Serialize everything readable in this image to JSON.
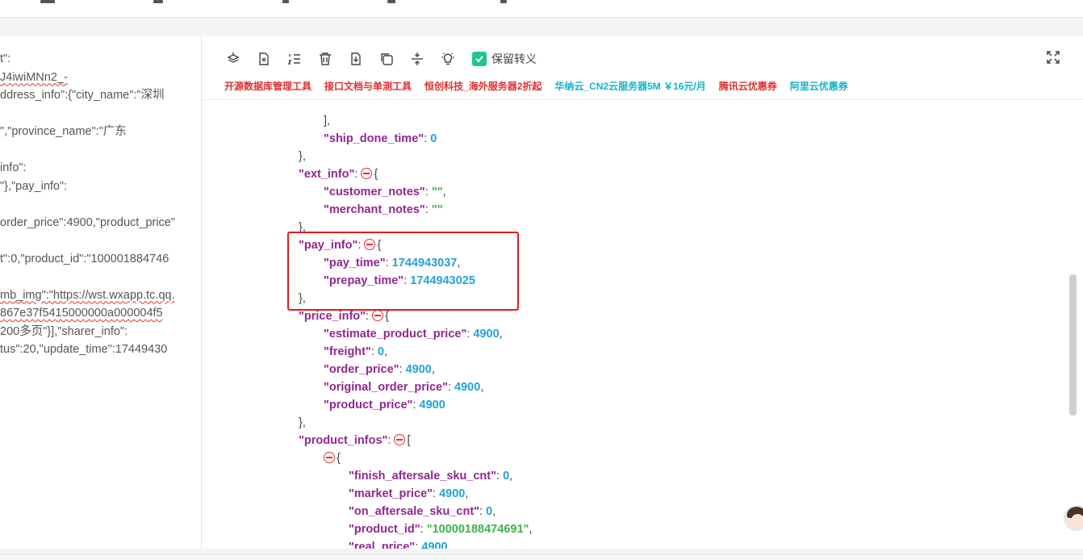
{
  "raw_lines": [
    "t\":",
    "J4iwiMNn2_-",
    "ddress_info\":{\"city_name\":\"深圳",
    "",
    "\",\"province_name\":\"广东",
    "",
    "info\":",
    "\"},\"pay_info\":",
    "",
    "order_price\":4900,\"product_price\"",
    "",
    "t\":0,\"product_id\":\"100001884746",
    "",
    "mb_img\":\"https://wst.wxapp.tc.qq.",
    "867e37f5415000000a000004f5",
    "200多页\"}],\"sharer_info\":",
    "tus\":20,\"update_time\":17449430"
  ],
  "toolbar": {
    "keep_escape_label": "保留转义",
    "links": [
      {
        "label": "开源数据库管理工具",
        "color": "#e03030"
      },
      {
        "label": "接口文档与单测工具",
        "color": "#e03030"
      },
      {
        "label": "恒创科技_海外服务器2折起",
        "color": "#e03030"
      },
      {
        "label": "华纳云_CN2云服务器5M ￥16元/月",
        "color": "#17b3c8"
      },
      {
        "label": "腾讯云优惠券",
        "color": "#e03030"
      },
      {
        "label": "阿里云优惠券",
        "color": "#17b3c8"
      }
    ]
  },
  "json_view": {
    "lines": [
      {
        "indent": 2,
        "parts": [
          {
            "t": "punct",
            "v": "],"
          }
        ]
      },
      {
        "indent": 2,
        "parts": [
          {
            "t": "key",
            "v": "\"ship_done_time\""
          },
          {
            "t": "punct",
            "v": ": "
          },
          {
            "t": "num",
            "v": "0"
          }
        ]
      },
      {
        "indent": 1,
        "parts": [
          {
            "t": "punct",
            "v": "},"
          }
        ]
      },
      {
        "indent": 1,
        "parts": [
          {
            "t": "key",
            "v": "\"ext_info\""
          },
          {
            "t": "punct",
            "v": ": "
          },
          {
            "t": "fold"
          },
          {
            "t": "punct",
            "v": "{"
          }
        ]
      },
      {
        "indent": 2,
        "parts": [
          {
            "t": "key",
            "v": "\"customer_notes\""
          },
          {
            "t": "punct",
            "v": ": "
          },
          {
            "t": "str",
            "v": "\"\""
          },
          {
            "t": "punct",
            "v": ","
          }
        ]
      },
      {
        "indent": 2,
        "parts": [
          {
            "t": "key",
            "v": "\"merchant_notes\""
          },
          {
            "t": "punct",
            "v": ": "
          },
          {
            "t": "str",
            "v": "\"\""
          }
        ]
      },
      {
        "indent": 1,
        "parts": [
          {
            "t": "punct",
            "v": "},"
          }
        ]
      },
      {
        "indent": 1,
        "parts": [
          {
            "t": "key",
            "v": "\"pay_info\""
          },
          {
            "t": "punct",
            "v": ": "
          },
          {
            "t": "fold"
          },
          {
            "t": "punct",
            "v": "{"
          }
        ]
      },
      {
        "indent": 2,
        "parts": [
          {
            "t": "key",
            "v": "\"pay_time\""
          },
          {
            "t": "punct",
            "v": ": "
          },
          {
            "t": "num",
            "v": "1744943037"
          },
          {
            "t": "punct",
            "v": ","
          }
        ]
      },
      {
        "indent": 2,
        "parts": [
          {
            "t": "key",
            "v": "\"prepay_time\""
          },
          {
            "t": "punct",
            "v": ": "
          },
          {
            "t": "num",
            "v": "1744943025"
          }
        ]
      },
      {
        "indent": 1,
        "parts": [
          {
            "t": "punct",
            "v": "},"
          }
        ]
      },
      {
        "indent": 1,
        "parts": [
          {
            "t": "key",
            "v": "\"price_info\""
          },
          {
            "t": "punct",
            "v": ": "
          },
          {
            "t": "fold"
          },
          {
            "t": "punct",
            "v": "{"
          }
        ]
      },
      {
        "indent": 2,
        "parts": [
          {
            "t": "key",
            "v": "\"estimate_product_price\""
          },
          {
            "t": "punct",
            "v": ": "
          },
          {
            "t": "num",
            "v": "4900"
          },
          {
            "t": "punct",
            "v": ","
          }
        ]
      },
      {
        "indent": 2,
        "parts": [
          {
            "t": "key",
            "v": "\"freight\""
          },
          {
            "t": "punct",
            "v": ": "
          },
          {
            "t": "num",
            "v": "0"
          },
          {
            "t": "punct",
            "v": ","
          }
        ]
      },
      {
        "indent": 2,
        "parts": [
          {
            "t": "key",
            "v": "\"order_price\""
          },
          {
            "t": "punct",
            "v": ": "
          },
          {
            "t": "num",
            "v": "4900"
          },
          {
            "t": "punct",
            "v": ","
          }
        ]
      },
      {
        "indent": 2,
        "parts": [
          {
            "t": "key",
            "v": "\"original_order_price\""
          },
          {
            "t": "punct",
            "v": ": "
          },
          {
            "t": "num",
            "v": "4900"
          },
          {
            "t": "punct",
            "v": ","
          }
        ]
      },
      {
        "indent": 2,
        "parts": [
          {
            "t": "key",
            "v": "\"product_price\""
          },
          {
            "t": "punct",
            "v": ": "
          },
          {
            "t": "num",
            "v": "4900"
          }
        ]
      },
      {
        "indent": 1,
        "parts": [
          {
            "t": "punct",
            "v": "},"
          }
        ]
      },
      {
        "indent": 1,
        "parts": [
          {
            "t": "key",
            "v": "\"product_infos\""
          },
          {
            "t": "punct",
            "v": ": "
          },
          {
            "t": "fold"
          },
          {
            "t": "punct",
            "v": "["
          }
        ]
      },
      {
        "indent": 2,
        "parts": [
          {
            "t": "fold"
          },
          {
            "t": "punct",
            "v": "{"
          }
        ]
      },
      {
        "indent": 3,
        "parts": [
          {
            "t": "key",
            "v": "\"finish_aftersale_sku_cnt\""
          },
          {
            "t": "punct",
            "v": ": "
          },
          {
            "t": "num",
            "v": "0"
          },
          {
            "t": "punct",
            "v": ","
          }
        ]
      },
      {
        "indent": 3,
        "parts": [
          {
            "t": "key",
            "v": "\"market_price\""
          },
          {
            "t": "punct",
            "v": ": "
          },
          {
            "t": "num",
            "v": "4900"
          },
          {
            "t": "punct",
            "v": ","
          }
        ]
      },
      {
        "indent": 3,
        "parts": [
          {
            "t": "key",
            "v": "\"on_aftersale_sku_cnt\""
          },
          {
            "t": "punct",
            "v": ": "
          },
          {
            "t": "num",
            "v": "0"
          },
          {
            "t": "punct",
            "v": ","
          }
        ]
      },
      {
        "indent": 3,
        "parts": [
          {
            "t": "key",
            "v": "\"product_id\""
          },
          {
            "t": "punct",
            "v": ": "
          },
          {
            "t": "str",
            "v": "\"10000188474691\""
          },
          {
            "t": "punct",
            "v": ","
          }
        ]
      },
      {
        "indent": 3,
        "parts": [
          {
            "t": "key",
            "v": "\"real_price\""
          },
          {
            "t": "punct",
            "v": ": "
          },
          {
            "t": "num",
            "v": "4900"
          }
        ]
      }
    ]
  },
  "colors": {
    "key": "#92278f",
    "number": "#25a0d8",
    "string": "#3ab54a",
    "highlight_box": "#e01a1a",
    "checkbox": "#22c58b"
  },
  "icons": [
    "format-icon",
    "clear-icon",
    "sort-icon",
    "delete-icon",
    "download-icon",
    "copy-icon",
    "compress-icon",
    "theme-icon",
    "check-icon",
    "fullscreen-icon"
  ]
}
